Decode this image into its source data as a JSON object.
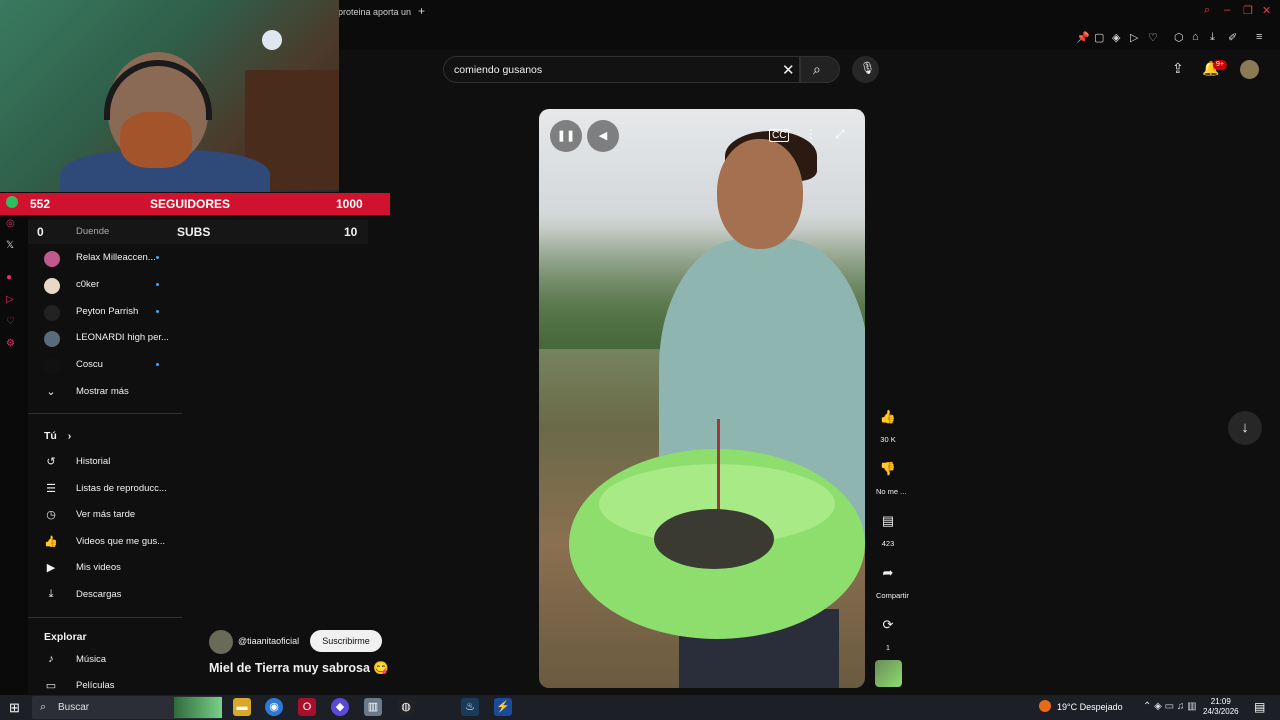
{
  "browser": {
    "tab_title": "proteina aporta un",
    "new_tab": "+"
  },
  "overlay": {
    "followers_current": "552",
    "followers_label": "SEGUIDORES",
    "followers_goal": "1000",
    "subs_current": "0",
    "subs_label": "SUBS",
    "subs_goal": "10"
  },
  "sidebar": {
    "subscriptions": [
      {
        "label": "Duende"
      },
      {
        "label": "Relax Milleaccen..."
      },
      {
        "label": "c0ker"
      },
      {
        "label": "Peyton Parrish"
      },
      {
        "label": "LEONARDI high per..."
      },
      {
        "label": "Coscu"
      }
    ],
    "show_more": "Mostrar más",
    "you_heading": "Tú",
    "you_items": [
      {
        "label": "Historial",
        "icon": "history-icon"
      },
      {
        "label": "Listas de reproducc...",
        "icon": "playlists-icon"
      },
      {
        "label": "Ver más tarde",
        "icon": "clock-icon"
      },
      {
        "label": "Videos que me gus...",
        "icon": "thumbs-up-icon"
      },
      {
        "label": "Mis videos",
        "icon": "my-videos-icon"
      },
      {
        "label": "Descargas",
        "icon": "download-icon"
      }
    ],
    "explore_heading": "Explorar",
    "explore_items": [
      {
        "label": "Música",
        "icon": "music-icon"
      },
      {
        "label": "Películas",
        "icon": "movies-icon"
      }
    ]
  },
  "search": {
    "query": "comiendo gusanos"
  },
  "header": {
    "notification_count": "9+"
  },
  "short": {
    "channel": "@tiaanitaoficial",
    "subscribe_label": "Suscribirme",
    "title": "Miel de Tierra muy sabrosa 😋",
    "likes": "30 K",
    "dislike_label": "No me ...",
    "comments": "423",
    "share_label": "Compartir",
    "remix_count": "1"
  },
  "taskbar": {
    "search_placeholder": "Buscar",
    "weather": "19°C  Despejado",
    "time": "21:09",
    "date": "24/3/2026"
  },
  "colors": {
    "overlay_red": "#d1122e",
    "basin_green": "#8ede6e",
    "youtube_bg": "#0f0f0f",
    "notification_red": "#cc0000"
  }
}
